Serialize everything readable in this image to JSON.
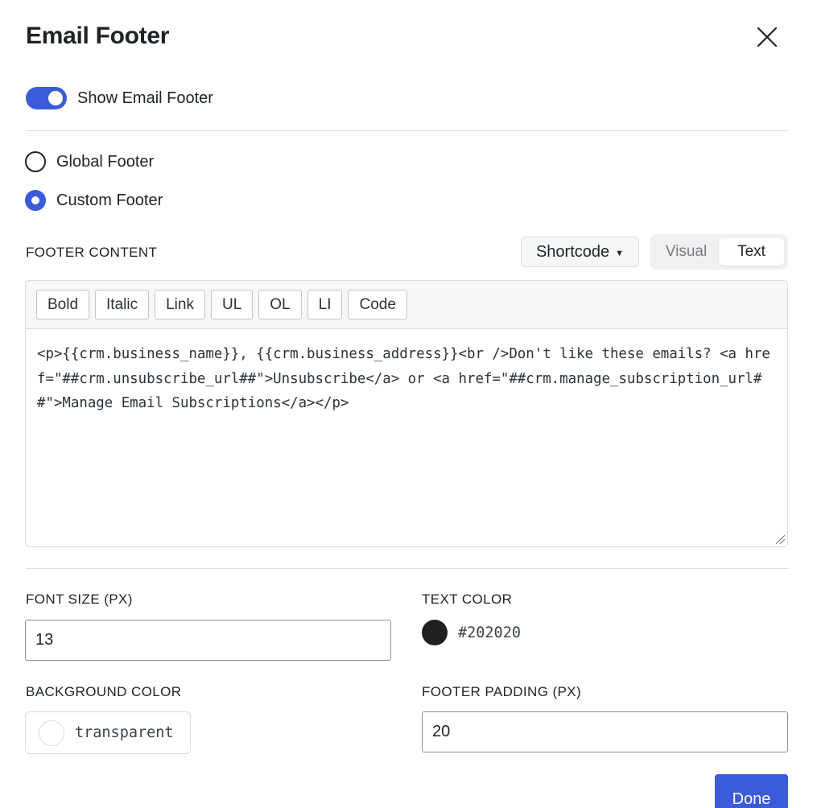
{
  "dialog": {
    "title": "Email Footer",
    "close_icon": "close-icon"
  },
  "show_footer": {
    "label": "Show Email Footer",
    "enabled": true
  },
  "footer_type": {
    "options": [
      {
        "label": "Global Footer",
        "selected": false
      },
      {
        "label": "Custom Footer",
        "selected": true
      }
    ]
  },
  "footer_content": {
    "label": "FOOTER CONTENT",
    "shortcode_label": "Shortcode",
    "modes": [
      {
        "label": "Visual",
        "active": false
      },
      {
        "label": "Text",
        "active": true
      }
    ],
    "toolbar": [
      "Bold",
      "Italic",
      "Link",
      "UL",
      "OL",
      "LI",
      "Code"
    ],
    "text": "<p>{{crm.business_name}}, {{crm.business_address}}<br />Don't like these emails? <a href=\"##crm.unsubscribe_url##\">Unsubscribe</a> or <a href=\"##crm.manage_subscription_url##\">Manage Email Subscriptions</a></p>"
  },
  "font_size": {
    "label": "FONT SIZE (PX)",
    "value": "13"
  },
  "text_color": {
    "label": "TEXT COLOR",
    "value": "#202020"
  },
  "background_color": {
    "label": "BACKGROUND COLOR",
    "value": "transparent"
  },
  "footer_padding": {
    "label": "FOOTER PADDING (PX)",
    "value": "20"
  },
  "actions": {
    "done_label": "Done"
  },
  "colors": {
    "accent": "#3b5bdb",
    "text_swatch": "#202020"
  }
}
